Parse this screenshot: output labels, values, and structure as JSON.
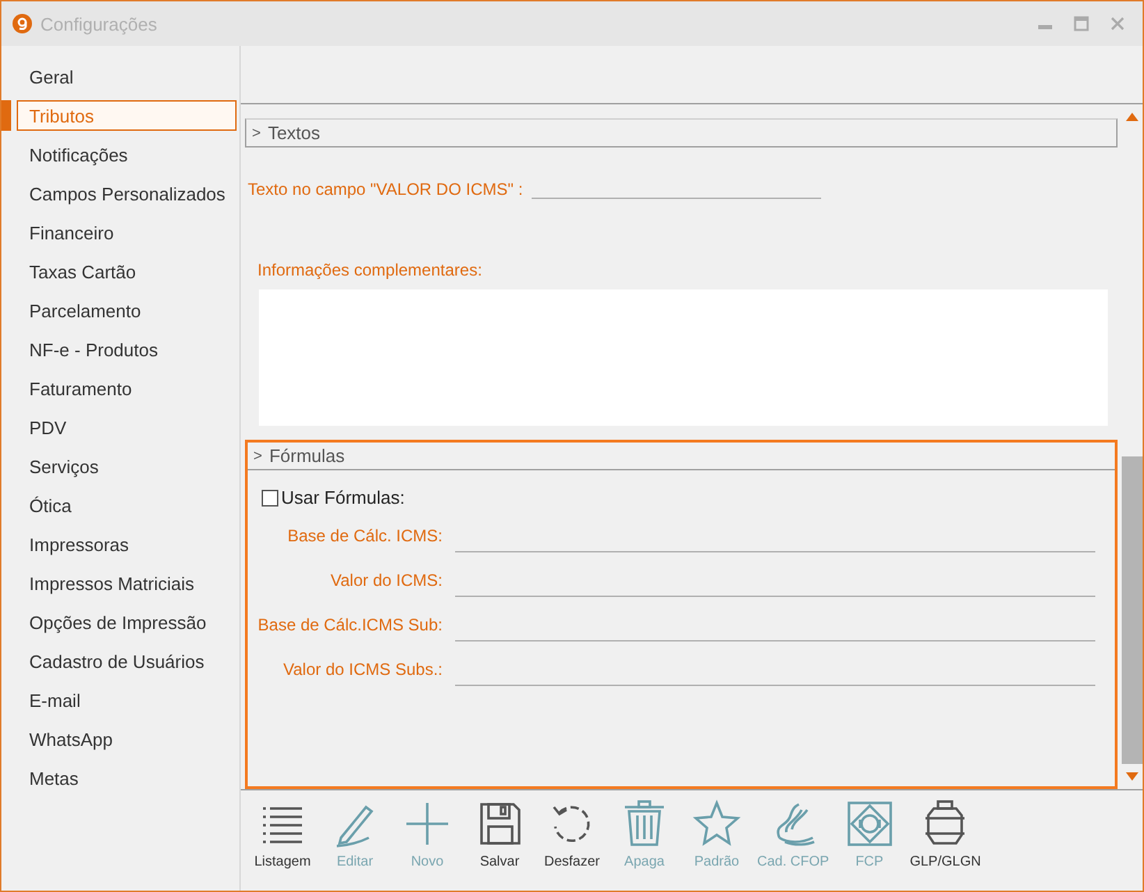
{
  "window": {
    "title": "Configurações"
  },
  "sidebar": {
    "items": [
      {
        "label": "Geral",
        "selected": false
      },
      {
        "label": "Tributos",
        "selected": true
      },
      {
        "label": "Notificações",
        "selected": false
      },
      {
        "label": "Campos Personalizados",
        "selected": false
      },
      {
        "label": "Financeiro",
        "selected": false
      },
      {
        "label": "Taxas Cartão",
        "selected": false
      },
      {
        "label": "Parcelamento",
        "selected": false
      },
      {
        "label": "NF-e - Produtos",
        "selected": false
      },
      {
        "label": "Faturamento",
        "selected": false
      },
      {
        "label": "PDV",
        "selected": false
      },
      {
        "label": "Serviços",
        "selected": false
      },
      {
        "label": "Ótica",
        "selected": false
      },
      {
        "label": "Impressoras",
        "selected": false
      },
      {
        "label": "Impressos Matriciais",
        "selected": false
      },
      {
        "label": "Opções de Impressão",
        "selected": false
      },
      {
        "label": "Cadastro de Usuários",
        "selected": false
      },
      {
        "label": "E-mail",
        "selected": false
      },
      {
        "label": "WhatsApp",
        "selected": false
      },
      {
        "label": "Metas",
        "selected": false
      }
    ]
  },
  "textos": {
    "marker": ">",
    "title": "Textos",
    "icms_field": {
      "label": "Texto no campo \"VALOR DO ICMS\" :"
    },
    "complementares": {
      "label": "Informações complementares:"
    }
  },
  "formulas": {
    "marker": ">",
    "title": "Fórmulas",
    "use": {
      "label": "Usar Fórmulas:",
      "checked": false
    },
    "fields": [
      {
        "label": "Base de Cálc. ICMS:"
      },
      {
        "label": "Valor do ICMS:"
      },
      {
        "label": "Base de Cálc.ICMS Sub:"
      },
      {
        "label": "Valor do ICMS Subs.:"
      }
    ]
  },
  "toolbar": [
    {
      "kind": "list",
      "label": "Listagem",
      "disabled": false
    },
    {
      "kind": "edit",
      "label": "Editar",
      "disabled": true
    },
    {
      "kind": "new",
      "label": "Novo",
      "disabled": true
    },
    {
      "kind": "save",
      "label": "Salvar",
      "disabled": false
    },
    {
      "kind": "undo",
      "label": "Desfazer",
      "disabled": false
    },
    {
      "kind": "delete",
      "label": "Apaga",
      "disabled": true
    },
    {
      "kind": "star",
      "label": "Padrão",
      "disabled": true
    },
    {
      "kind": "cfop",
      "label": "Cad. CFOP",
      "disabled": true
    },
    {
      "kind": "fcp",
      "label": "FCP",
      "disabled": true
    },
    {
      "kind": "gas",
      "label": "GLP/GLGN",
      "disabled": false
    }
  ]
}
